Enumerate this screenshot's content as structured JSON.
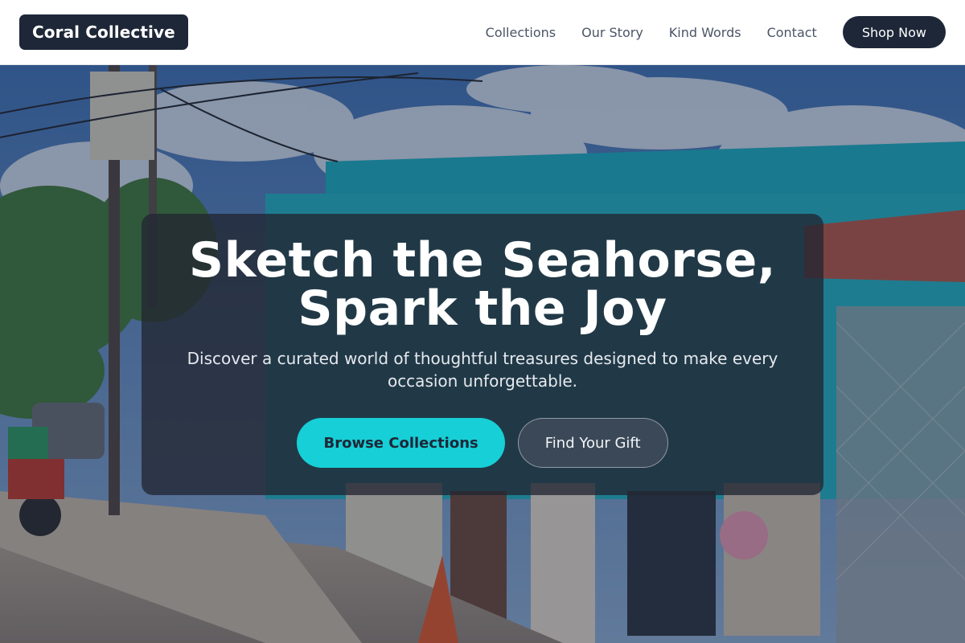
{
  "header": {
    "logo": "Coral Collective",
    "nav": [
      {
        "label": "Collections"
      },
      {
        "label": "Our Story"
      },
      {
        "label": "Kind Words"
      },
      {
        "label": "Contact"
      }
    ],
    "cta_label": "Shop Now"
  },
  "hero": {
    "title_line1": "Sketch the Seahorse,",
    "title_line2": "Spark the Joy",
    "subtitle": "Discover a curated world of thoughtful treasures designed to make every occasion unforgettable.",
    "primary_button": "Browse Collections",
    "secondary_button": "Find Your Gift"
  },
  "colors": {
    "brand_dark": "#1e2738",
    "accent_teal": "#17cfd6"
  }
}
